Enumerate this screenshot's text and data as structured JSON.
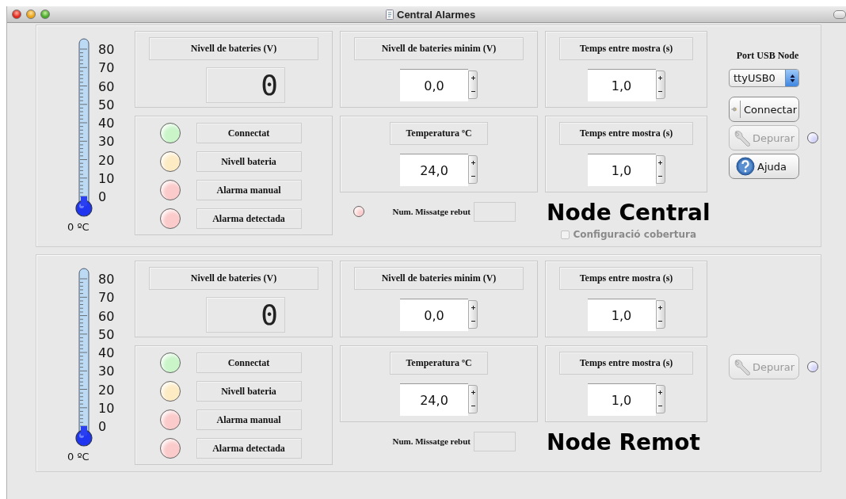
{
  "window": {
    "title": "Central Alarmes"
  },
  "nodes": [
    {
      "thermometer": {
        "scale": [
          "80",
          "70",
          "60",
          "50",
          "40",
          "30",
          "20",
          "10",
          "0"
        ],
        "reading": "0 ºC"
      },
      "battery": {
        "label": "Nivell de bateries (V)",
        "display": "0"
      },
      "indicators": [
        {
          "label": "Connectat",
          "color": "#c9f5c9"
        },
        {
          "label": "Nivell bateria",
          "color": "#fdebc4"
        },
        {
          "label": "Alarma manual",
          "color": "#fbcaca"
        },
        {
          "label": "Alarma detectada",
          "color": "#fbcaca"
        }
      ],
      "settings": [
        {
          "label": "Nivell de bateries minim (V)",
          "value": "0,0"
        },
        {
          "label": "Temps entre mostra (s)",
          "value": "1,0"
        },
        {
          "label": "Temperatura ºC",
          "value": "24,0"
        },
        {
          "label": "Temps entre mostra (s)",
          "value": "1,0"
        }
      ],
      "message": {
        "status_light": {
          "color": "#fbcaca"
        },
        "label": "Num. Missatge rebut"
      },
      "title": "Node Central",
      "coverage": {
        "label": "Configuració cobertura",
        "checked": false,
        "disabled": true
      },
      "controls": [
        {
          "kind": "label",
          "text": "Port USB Node"
        },
        {
          "kind": "select",
          "value": "ttyUSB0"
        },
        {
          "kind": "connect",
          "label": "Connectar",
          "disabled": false
        },
        {
          "kind": "debug",
          "label": "Depurar",
          "disabled": true,
          "status_light": {
            "color": "#d4d4fa"
          }
        },
        {
          "kind": "help",
          "label": "Ajuda",
          "disabled": false
        }
      ]
    },
    {
      "thermometer": {
        "scale": [
          "80",
          "70",
          "60",
          "50",
          "40",
          "30",
          "20",
          "10",
          "0"
        ],
        "reading": "0 ºC"
      },
      "battery": {
        "label": "Nivell de bateries (V)",
        "display": "0"
      },
      "indicators": [
        {
          "label": "Connectat",
          "color": "#c9f5c9"
        },
        {
          "label": "Nivell bateria",
          "color": "#fdebc4"
        },
        {
          "label": "Alarma manual",
          "color": "#fbcaca"
        },
        {
          "label": "Alarma detectada",
          "color": "#fbcaca"
        }
      ],
      "settings": [
        {
          "label": "Nivell de bateries minim (V)",
          "value": "0,0"
        },
        {
          "label": "Temps entre mostra (s)",
          "value": "1,0"
        },
        {
          "label": "Temperatura ºC",
          "value": "24,0"
        },
        {
          "label": "Temps entre mostra (s)",
          "value": "1,0"
        }
      ],
      "message": {
        "label": "Num. Missatge rebut"
      },
      "title": "Node Remot",
      "controls": [
        {
          "kind": "debug",
          "label": "Depurar",
          "disabled": true,
          "status_light": {
            "color": "#d4d4fa"
          }
        }
      ]
    }
  ]
}
